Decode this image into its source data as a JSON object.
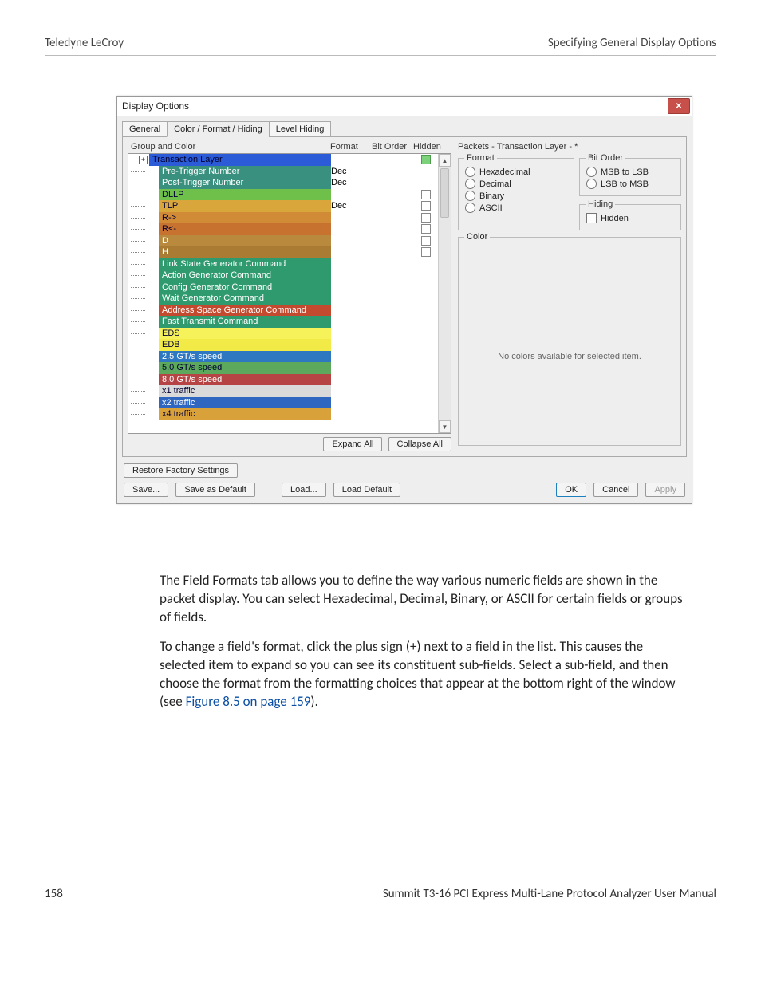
{
  "page": {
    "header_left": "Teledyne LeCroy",
    "header_right": "Specifying General Display Options",
    "footer_page": "158",
    "footer_title": "Summit T3-16 PCI Express Multi-Lane Protocol Analyzer User Manual"
  },
  "dialog": {
    "title": "Display Options",
    "tabs": {
      "general": "General",
      "color": "Color / Format / Hiding",
      "level": "Level Hiding"
    },
    "headers": {
      "group": "Group and Color",
      "format": "Format",
      "bitorder": "Bit Order",
      "hidden": "Hidden"
    },
    "rows": [
      {
        "label": "Transaction Layer",
        "bg": "#2b5bd6",
        "text": "dark",
        "fmt": "",
        "hidden": "green",
        "hasPlus": true
      },
      {
        "label": "Pre-Trigger Number",
        "bg": "#3a907f",
        "fmt": "Dec"
      },
      {
        "label": "Post-Trigger Number",
        "bg": "#3a907f",
        "fmt": "Dec"
      },
      {
        "label": "DLLP",
        "bg": "#6fc04b",
        "text": "dark",
        "fmt": "",
        "hidden": "box"
      },
      {
        "label": "TLP",
        "bg": "#d9a63c",
        "text": "dark",
        "fmt": "Dec",
        "hidden": "box"
      },
      {
        "label": "R->",
        "bg": "#d18a36",
        "text": "dark",
        "hidden": "box"
      },
      {
        "label": "R<-",
        "bg": "#c87230",
        "text": "dark",
        "hidden": "box"
      },
      {
        "label": "D",
        "bg": "#b98a3e",
        "hidden": "box"
      },
      {
        "label": "H",
        "bg": "#a97b33",
        "hidden": "box"
      },
      {
        "label": "Link State Generator Command",
        "bg": "#2f9a6e"
      },
      {
        "label": "Action Generator Command",
        "bg": "#2f9a6e"
      },
      {
        "label": "Config Generator Command",
        "bg": "#2f9a6e"
      },
      {
        "label": "Wait Generator Command",
        "bg": "#2f9a6e"
      },
      {
        "label": "Address Space Generator Command",
        "bg": "#c44a2f"
      },
      {
        "label": "Fast Transmit Command",
        "bg": "#2f9a6e"
      },
      {
        "label": "EDS",
        "bg": "#f6f259",
        "text": "dark"
      },
      {
        "label": "EDB",
        "bg": "#f1ea47",
        "text": "dark"
      },
      {
        "label": "2.5 GT/s speed",
        "bg": "#2e78c2"
      },
      {
        "label": "5.0 GT/s speed",
        "bg": "#5ca85c",
        "text": "dark"
      },
      {
        "label": "8.0 GT/s speed",
        "bg": "#b64444"
      },
      {
        "label": "x1 traffic",
        "bg": "#dadada",
        "text": "dark"
      },
      {
        "label": "x2 traffic",
        "bg": "#2f66bf"
      },
      {
        "label": "x4 traffic",
        "bg": "#d9a13a",
        "text": "dark"
      }
    ],
    "btns": {
      "expand": "Expand All",
      "collapse": "Collapse All",
      "restore": "Restore Factory Settings",
      "save": "Save...",
      "savedef": "Save as Default",
      "load": "Load...",
      "loaddef": "Load Default",
      "ok": "OK",
      "cancel": "Cancel",
      "apply": "Apply"
    },
    "right": {
      "heading": "Packets - Transaction Layer - *",
      "format_label": "Format",
      "format_opts": {
        "hex": "Hexadecimal",
        "dec": "Decimal",
        "bin": "Binary",
        "asc": "ASCII"
      },
      "bitorder_label": "Bit Order",
      "bitorder_opts": {
        "msb": "MSB to LSB",
        "lsb": "LSB to MSB"
      },
      "hiding_label": "Hiding",
      "hidden_check": "Hidden",
      "color_label": "Color",
      "color_msg": "No colors available for selected item."
    }
  },
  "body": {
    "p1": "The Field Formats tab allows you to define the way various numeric fields are shown in the packet display. You can select Hexadecimal, Decimal, Binary, or ASCII for certain fields or groups of fields.",
    "p2a": "To change a field's format, click the plus sign (+) next to a field in the list. This causes the selected item to expand so you can see its constituent sub-fields. Select a sub-field, and then choose the format from the formatting choices that appear at the bottom right of the window (see ",
    "p2_link": "Figure 8.5 on page 159",
    "p2b": ")."
  }
}
